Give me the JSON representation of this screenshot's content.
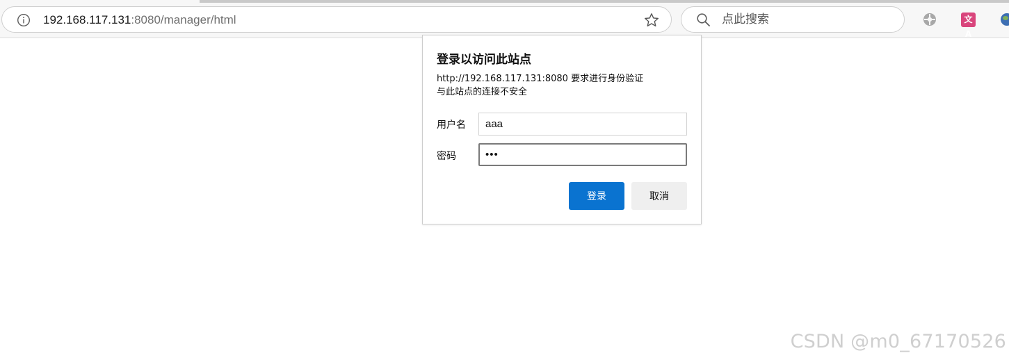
{
  "browser": {
    "address": {
      "host": "192.168.117.131",
      "rest": ":8080/manager/html"
    },
    "search": {
      "placeholder": "点此搜索"
    },
    "extensions": {
      "translate_label": "文A"
    }
  },
  "dialog": {
    "title": "登录以访问此站点",
    "message_line1": "http://192.168.117.131:8080 要求进行身份验证",
    "message_line2": "与此站点的连接不安全",
    "username_label": "用户名",
    "username_value": "aaa",
    "password_label": "密码",
    "password_value": "aaa",
    "login_label": "登录",
    "cancel_label": "取消"
  },
  "watermark": {
    "text": "CSDN @m0_67170526"
  },
  "colors": {
    "primary_button": "#0a73d0",
    "secondary_button": "#efefef"
  },
  "icons": [
    "info-icon",
    "star-icon",
    "search-icon",
    "extension-icon",
    "translate-icon",
    "globe-icon"
  ]
}
